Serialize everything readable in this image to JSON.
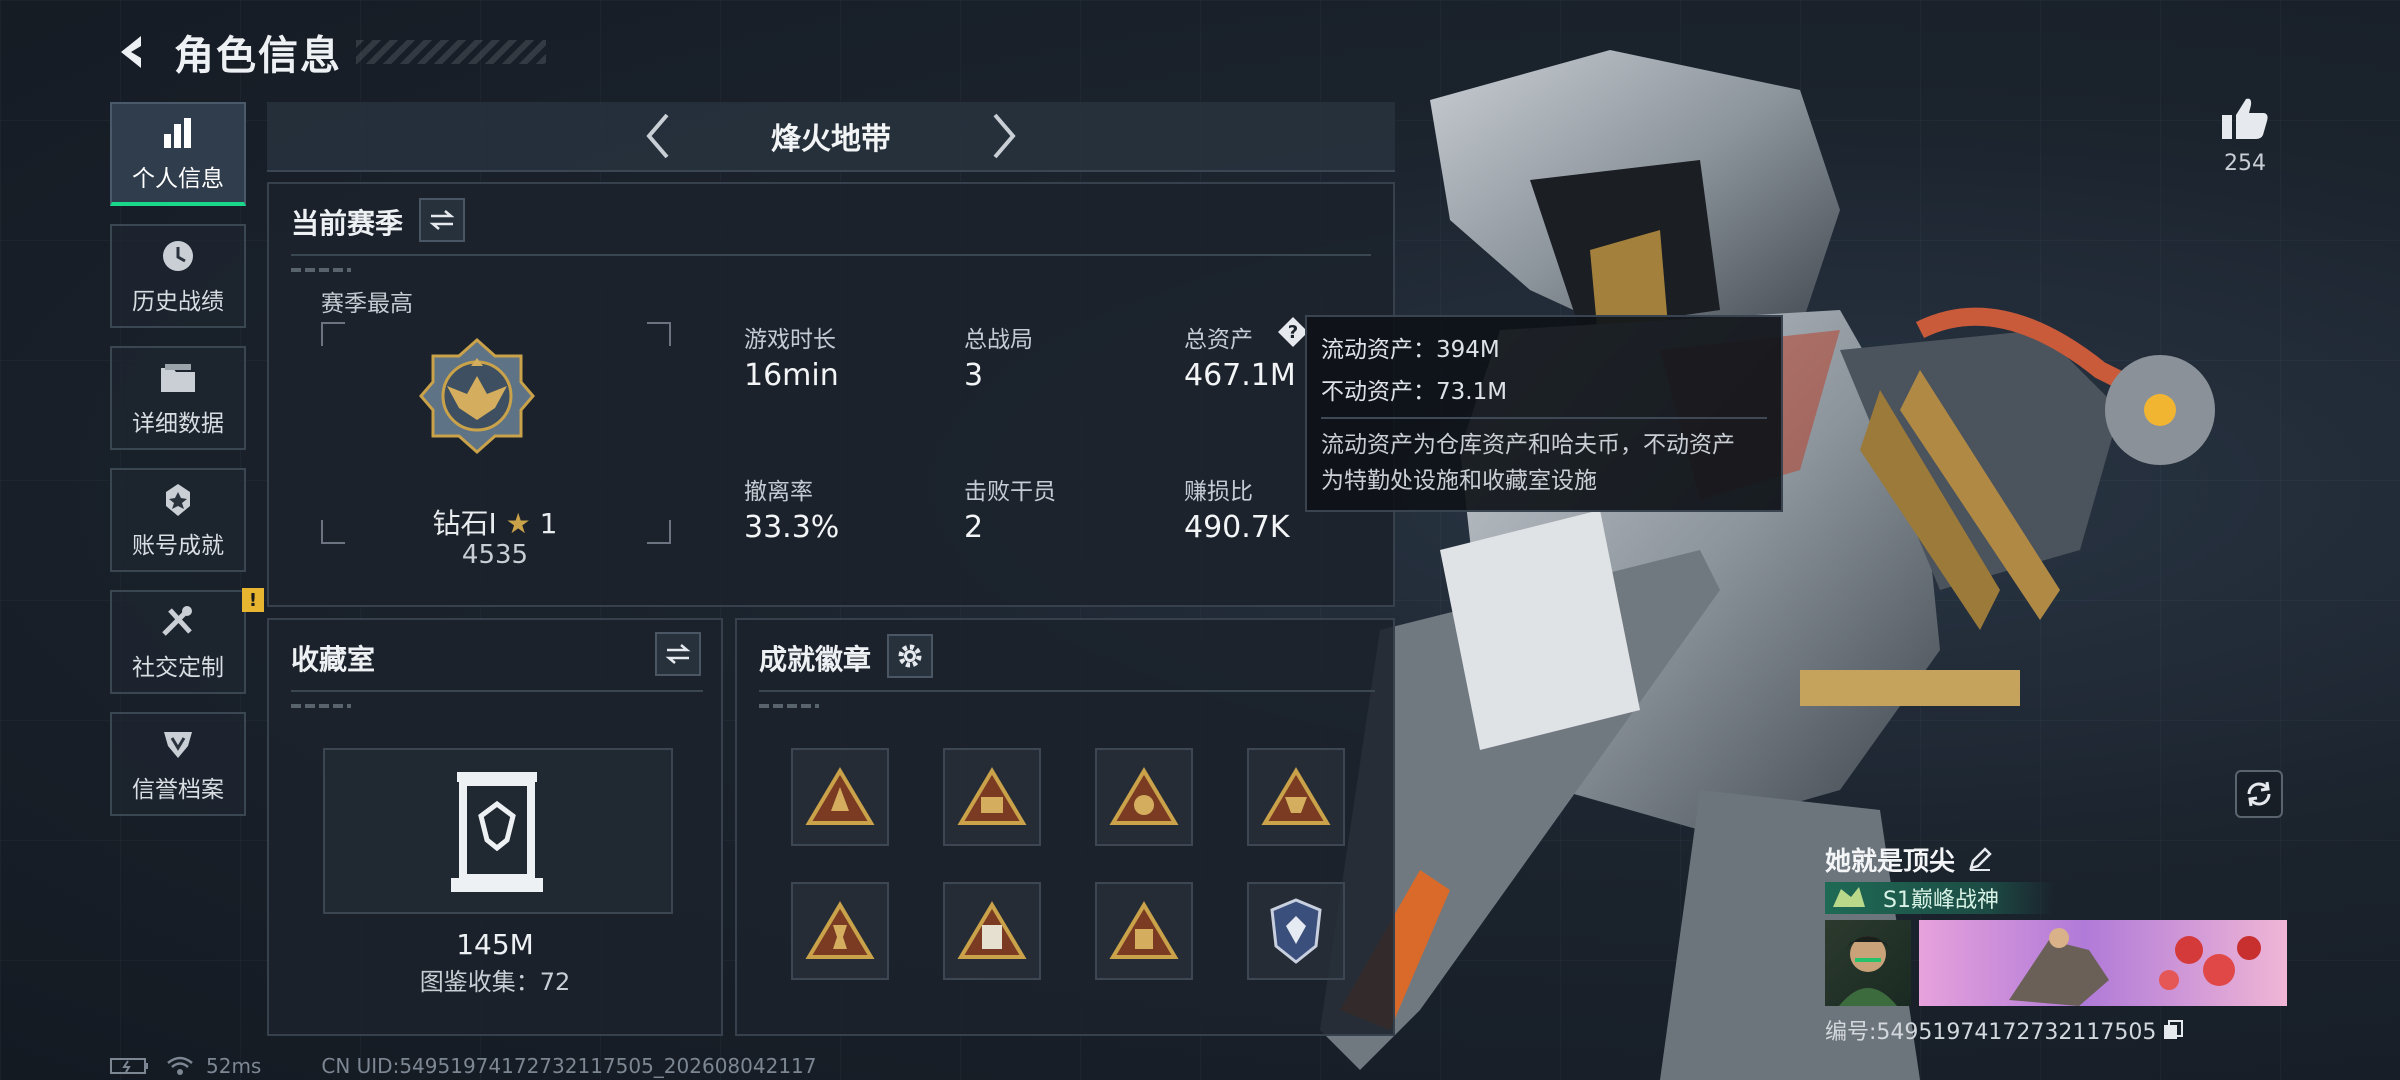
{
  "header": {
    "title": "角色信息"
  },
  "sidebar": {
    "items": [
      {
        "label": "个人信息",
        "icon": "bar-chart-icon",
        "active": true
      },
      {
        "label": "历史战绩",
        "icon": "history-clock-icon"
      },
      {
        "label": "详细数据",
        "icon": "folder-icon"
      },
      {
        "label": "账号成就",
        "icon": "achievement-medal-icon"
      },
      {
        "label": "社交定制",
        "icon": "tools-icon",
        "alert": "!"
      },
      {
        "label": "信誉档案",
        "icon": "credit-shield-icon"
      }
    ]
  },
  "mode": {
    "title": "烽火地带"
  },
  "season": {
    "title": "当前赛季",
    "best_label": "赛季最高",
    "rank_name": "钻石Ⅰ",
    "rank_stars": "1",
    "rank_score": "4535",
    "stats": [
      {
        "label": "游戏时长",
        "value": "16min"
      },
      {
        "label": "总战局",
        "value": "3"
      },
      {
        "label": "总资产",
        "value": "467.1M"
      },
      {
        "label": "撤离率",
        "value": "33.3%"
      },
      {
        "label": "击败干员",
        "value": "2"
      },
      {
        "label": "赚损比",
        "value": "490.7K"
      }
    ]
  },
  "tooltip": {
    "liquid": "流动资产：394M",
    "fixed": "不动资产：73.1M",
    "desc_line1": "流动资产为仓库资产和哈夫币，不动资产",
    "desc_line2": "为特勤处设施和收藏室设施"
  },
  "collection": {
    "title": "收藏室",
    "value": "145M",
    "catalog": "图鉴收集：72"
  },
  "badges": {
    "title": "成就徽章",
    "items": [
      "badge-triangle-gold-1",
      "badge-triangle-gold-2",
      "badge-triangle-gold-3",
      "badge-triangle-gold-4",
      "badge-triangle-gold-5",
      "badge-triangle-gold-6",
      "badge-triangle-gold-7",
      "badge-shield-blue"
    ]
  },
  "likes": {
    "count": "254"
  },
  "profile": {
    "nickname": "她就是顶尖",
    "title": "S1巅峰战神",
    "uid": "编号:5495197417273211750​5"
  },
  "status": {
    "ping": "52ms",
    "cn_uid": "CN UID:5495197417273211750​5_202608042117"
  },
  "colors": {
    "accent": "#19d88a",
    "alert": "#e8b530",
    "gold": "#c9a24a"
  }
}
